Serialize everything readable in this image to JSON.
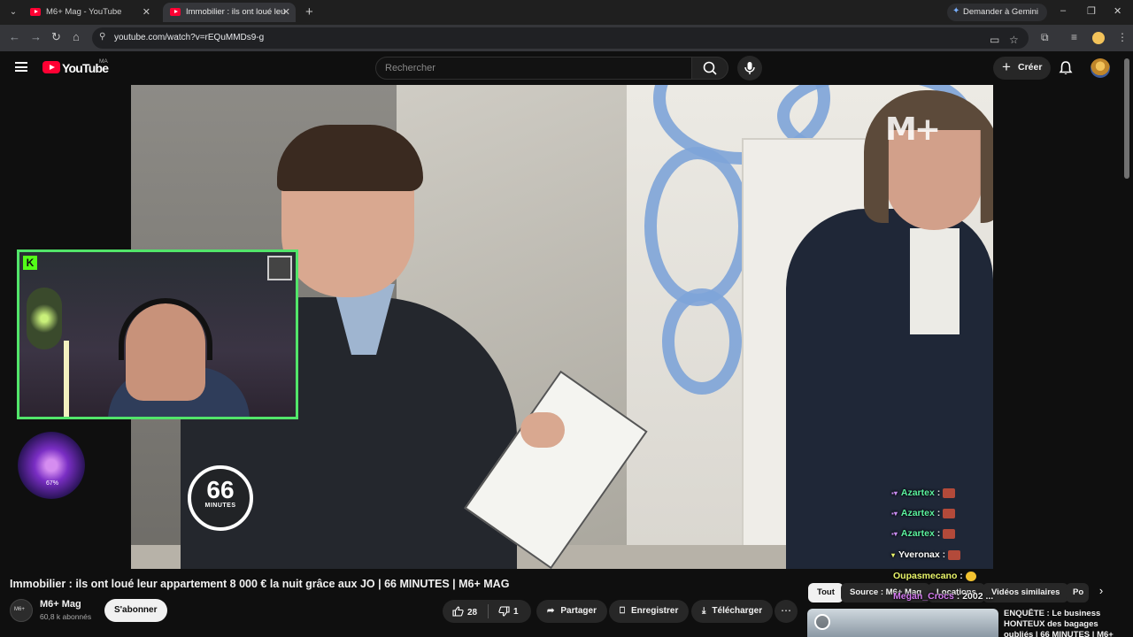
{
  "browser": {
    "tabs": [
      {
        "label": "M6+ Mag - YouTube",
        "active": false
      },
      {
        "label": "Immobilier : ils ont loué leur appartement",
        "active": true
      }
    ],
    "new_tab": "+",
    "gemini_label": "Demander à Gemini",
    "url": "youtube.com/watch?v=rEQuMMDs9-g",
    "window_controls": [
      "–",
      "❐",
      "✕"
    ]
  },
  "youtube": {
    "logo": "YouTube",
    "region": "MA",
    "search_placeholder": "Rechercher",
    "create_label": "Créer"
  },
  "video": {
    "watermark": "M+",
    "badge_number": "66",
    "badge_label": "MINUTES",
    "gem_percent": "67%",
    "kick_logo": "K",
    "chat": [
      {
        "user": "Azartex",
        "text": ":",
        "color": "#5cf2a0"
      },
      {
        "user": "Azartex",
        "text": ":",
        "color": "#5cf2a0"
      },
      {
        "user": "Azartex",
        "text": ":",
        "color": "#5cf2a0"
      },
      {
        "user": "Yveronax",
        "text": ":",
        "color": "#ffffff"
      },
      {
        "user": "Oupasmecano",
        "text": ":",
        "color": "#e9f56a"
      },
      {
        "user": "Megan_Crocs",
        "text": ": 2002 ...",
        "color": "#d47af0"
      }
    ]
  },
  "meta": {
    "title": "Immobilier : ils ont loué leur appartement 8 000 € la nuit grâce aux JO | 66 MINUTES | M6+ MAG",
    "channel_name": "M6+ Mag",
    "subscribers": "60,8 k abonnés",
    "subscribe_label": "S'abonner",
    "likes": "28",
    "dislikes": "1",
    "share_label": "Partager",
    "save_label": "Enregistrer",
    "download_label": "Télécharger",
    "more_label": "⋯"
  },
  "sidebar": {
    "chips": [
      "Tout",
      "Source : M6+ Mag",
      "Locations",
      "Vidéos similaires",
      "Po"
    ],
    "recommendation_title": "ENQUÊTE : Le business HONTEUX des bagages oubliés | 66 MINUTES | M6+"
  }
}
